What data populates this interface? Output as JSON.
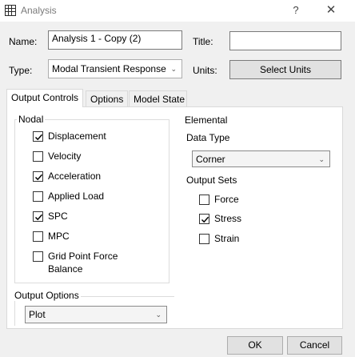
{
  "window": {
    "title": "Analysis",
    "help": "?",
    "close": "✕"
  },
  "header": {
    "name_label": "Name:",
    "name_value": "Analysis 1 - Copy (2)",
    "title_label": "Title:",
    "title_value": "",
    "type_label": "Type:",
    "type_value": "Modal Transient Response",
    "units_label": "Units:",
    "select_units": "Select Units"
  },
  "tabs": [
    {
      "label": "Output Controls"
    },
    {
      "label": "Options"
    },
    {
      "label": "Model State"
    }
  ],
  "nodal": {
    "title": "Nodal",
    "items": [
      {
        "label": "Displacement",
        "checked": true
      },
      {
        "label": "Velocity",
        "checked": false
      },
      {
        "label": "Acceleration",
        "checked": true
      },
      {
        "label": "Applied Load",
        "checked": false
      },
      {
        "label": "SPC",
        "checked": true
      },
      {
        "label": "MPC",
        "checked": false
      },
      {
        "label": "Grid Point Force",
        "label2": "Balance",
        "checked": false
      }
    ]
  },
  "elemental": {
    "title": "Elemental",
    "data_type_label": "Data Type",
    "data_type_value": "Corner",
    "output_sets_label": "Output Sets",
    "items": [
      {
        "label": "Force",
        "checked": false
      },
      {
        "label": "Stress",
        "checked": true
      },
      {
        "label": "Strain",
        "checked": false
      }
    ]
  },
  "output_options": {
    "title": "Output Options",
    "value": "Plot"
  },
  "footer": {
    "ok": "OK",
    "cancel": "Cancel"
  }
}
